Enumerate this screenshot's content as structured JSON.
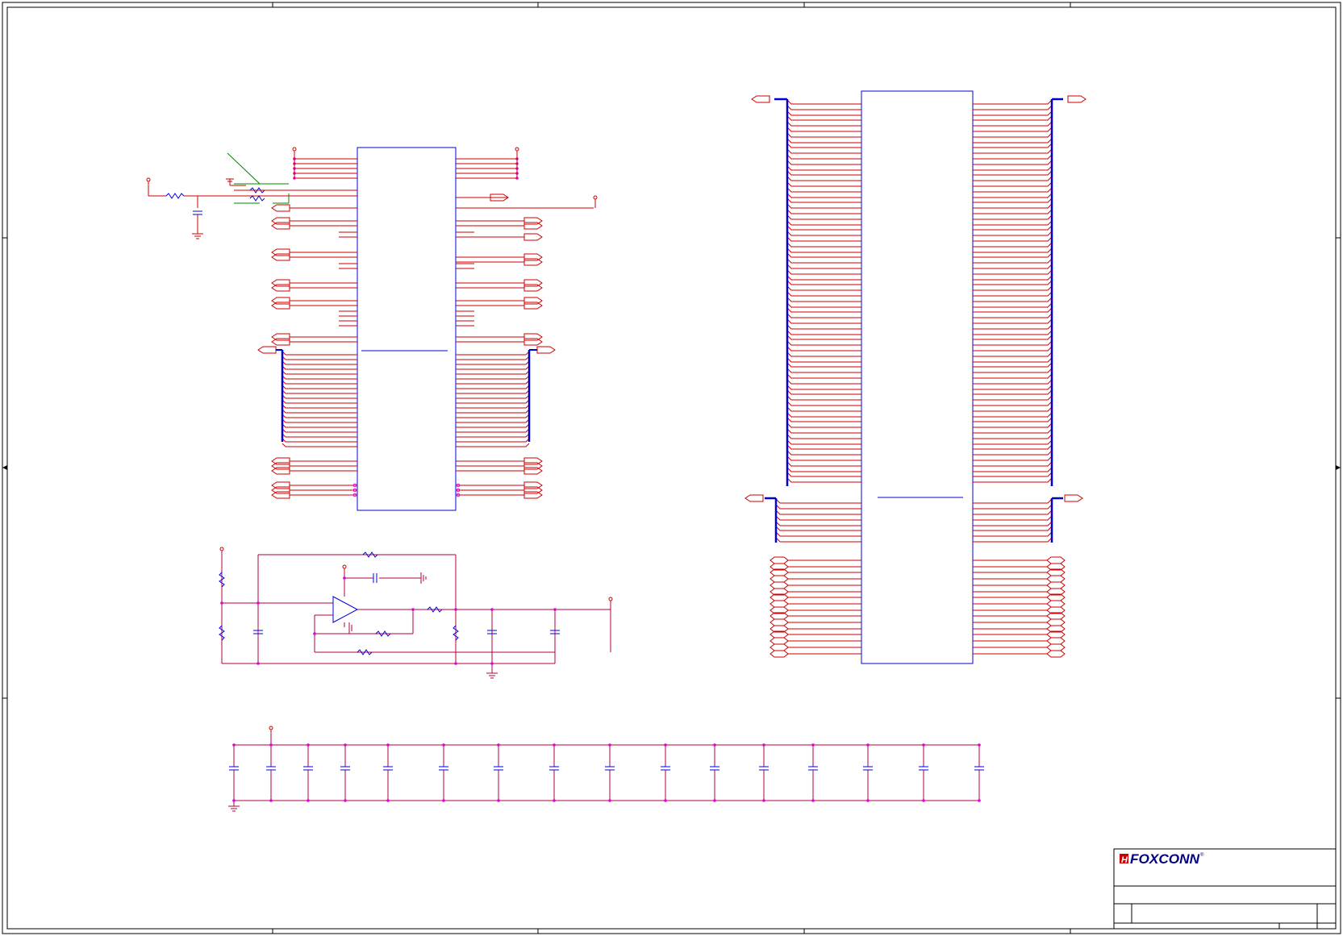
{
  "title_block": {
    "logo_text": "FOXCONN",
    "logo_mark": "H",
    "registered_mark": "®"
  },
  "colors": {
    "wire": "#cc0000",
    "wire_alt": "#b00040",
    "bus": "#0000cc",
    "component": "#0000dd",
    "junction": "#e000e0",
    "annotation": "#008800",
    "frame": "#000000"
  }
}
